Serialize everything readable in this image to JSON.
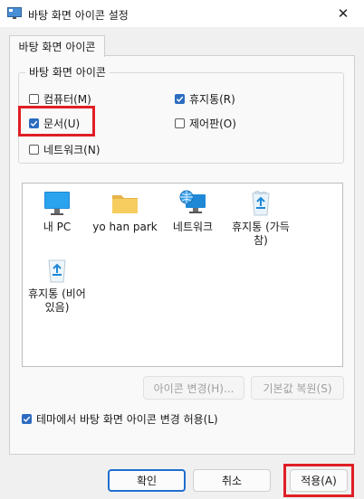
{
  "window": {
    "title": "바탕 화면 아이콘 설정",
    "close_glyph": "✕"
  },
  "tab": {
    "label": "바탕 화면 아이콘"
  },
  "group": {
    "legend": "바탕 화면 아이콘",
    "checkboxes": [
      {
        "label": "컴퓨터(M)",
        "checked": false
      },
      {
        "label": "휴지통(R)",
        "checked": true
      },
      {
        "label": "문서(U)",
        "checked": true
      },
      {
        "label": "제어판(O)",
        "checked": false
      },
      {
        "label": "네트워크(N)",
        "checked": false
      }
    ]
  },
  "icons": [
    {
      "label": "내 PC",
      "icon": "monitor-icon"
    },
    {
      "label": "yo han park",
      "icon": "folder-icon"
    },
    {
      "label": "네트워크",
      "icon": "network-icon"
    },
    {
      "label": "휴지통 (가득 참)",
      "icon": "recycle-bin-full-icon"
    },
    {
      "label": "휴지통 (비어 있음)",
      "icon": "recycle-bin-empty-icon"
    }
  ],
  "buttons": {
    "change_icon": "아이콘 변경(H)...",
    "restore_default": "기본값 복원(S)",
    "ok": "확인",
    "cancel": "취소",
    "apply": "적용(A)"
  },
  "theme_option": {
    "label": "테마에서 바탕 화면 아이콘 변경 허용(L)",
    "checked": true
  },
  "colors": {
    "accent": "#2d6cc0",
    "highlight": "#e01e26"
  }
}
